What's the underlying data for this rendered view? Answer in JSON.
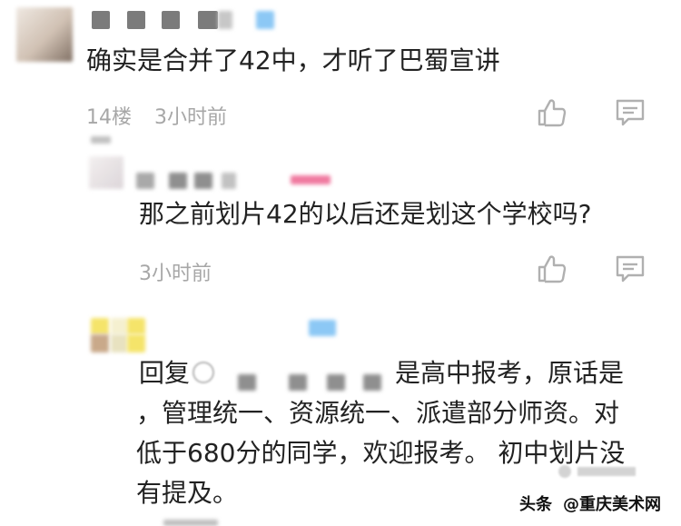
{
  "comment_1": {
    "text": "确实是合并了42中，才听了巴蜀宣讲",
    "floor": "14楼",
    "time": "3小时前"
  },
  "reply_1": {
    "text": "那之前划片42的以后还是划这个学校吗?",
    "time": "3小时前"
  },
  "reply_2": {
    "reply_prefix": "回复",
    "line_1_tail": "是高中报考，原话是",
    "line_2": "，管理统一、资源统一、派遣部分师资。对",
    "line_3": "低于680分的同学，欢迎报考。 初中划片没",
    "line_4": "有提及。"
  },
  "watermark": {
    "source": "头条",
    "handle": "@重庆美术网"
  },
  "icons": {
    "like": "thumbs-up-icon",
    "comment": "comment-icon",
    "at": "at-icon"
  },
  "colors": {
    "text": "#222222",
    "meta": "#a7a7a7",
    "blur_gray": "#7b7b7b",
    "blur_blue": "#8cc8f5",
    "blur_pink": "#f07aa0",
    "blur_yellow": "#f5e46a"
  }
}
